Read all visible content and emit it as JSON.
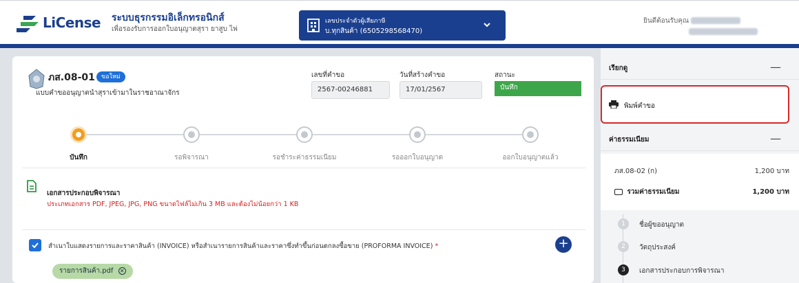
{
  "header": {
    "logo_text": "LiCense",
    "app_title": "ระบบธุรกรรมอิเล็กทรอนิกส์",
    "app_subtitle": "เพื่อรองรับการออกใบอนุญาตสุรา ยาสูบ ไพ่",
    "tax_label": "เลขประจำตัวผู้เสียภาษี",
    "tax_value": "บ.ทุกสินค้า (6505298568470)",
    "welcome": "ยินดีต้อนรับคุณ"
  },
  "form": {
    "code": "ภส.08-01",
    "badge": "ขอใหม่",
    "description": "แบบคำขออนุญาตนำสุราเข้ามาในราชอาณาจักร",
    "request_no_label": "เลขที่คำขอ",
    "request_no": "2567-00246881",
    "created_label": "วันที่สร้างคำขอ",
    "created_date": "17/01/2567",
    "status_label": "สถานะ",
    "status": "บันทึก"
  },
  "steps": [
    {
      "label": "บันทึก",
      "active": true
    },
    {
      "label": "รอพิจารณา",
      "active": false
    },
    {
      "label": "รอชำระค่าธรรมเนียม",
      "active": false
    },
    {
      "label": "รอออกใบอนุญาต",
      "active": false
    },
    {
      "label": "ออกใบอนุญาตแล้ว",
      "active": false
    }
  ],
  "documents": {
    "title": "เอกสารประกอบพิจารณา",
    "note": "ประเภทเอกสาร PDF, JPEG, JPG, PNG ขนาดไฟล์ไม่เกิน 3 MB และต้องไม่น้อยกว่า 1 KB",
    "item_label": "สำเนาใบแสดงรายการและราคาสินค้า (INVOICE) หรือสำเนารายการสินค้าและราคาซึ่งทำขึ้นก่อนตกลงซื้อขาย (PROFORMA INVOICE)",
    "required_mark": "*",
    "file_chip": "รายการสินค้า.pdf",
    "add_symbol": "+"
  },
  "side": {
    "menu_title": "เรียกดู",
    "collapse_symbol": "—",
    "print_label": "พิมพ์คำขอ",
    "fee_title": "ค่าธรรมเนียม",
    "fee_item": "ภส.08-02 (ก)",
    "fee_item_amount": "1,200 บาท",
    "fee_total_label": "รวมค่าธรรมเนียม",
    "fee_total_amount": "1,200 บาท",
    "nav": [
      {
        "num": "1",
        "label": "ชื่อผู้ขออนุญาต",
        "active": false
      },
      {
        "num": "2",
        "label": "วัตถุประสงค์",
        "active": false
      },
      {
        "num": "3",
        "label": "เอกสารประกอบการพิจารณา",
        "active": true
      }
    ]
  },
  "colors": {
    "brand": "#1b3f8f",
    "accent": "#1e6fd9",
    "status_green": "#3ea64a",
    "step_active": "#f39c1f",
    "highlight_red": "#d62828"
  }
}
